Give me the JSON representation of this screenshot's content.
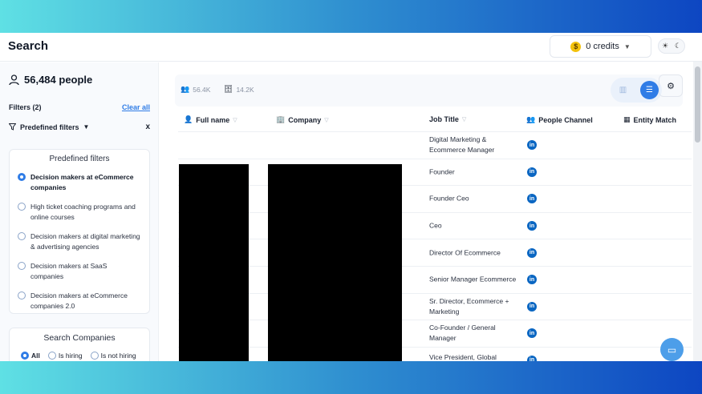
{
  "header": {
    "title": "Search",
    "credits": "0 credits",
    "coin_symbol": "$",
    "theme_icons": [
      "sun-icon",
      "moon-icon"
    ]
  },
  "sidebar": {
    "people_count": "56,484 people",
    "filters_label": "Filters (2)",
    "clear_all": "Clear all",
    "predefined_toggle": "Predefined filters",
    "close_symbol": "x",
    "predefined_panel": {
      "title": "Predefined filters",
      "options": [
        {
          "label": "Decision makers at eCommerce companies",
          "selected": true
        },
        {
          "label": "High ticket coaching programs and online courses",
          "selected": false
        },
        {
          "label": "Decision makers at digital marketing & advertising agencies",
          "selected": false
        },
        {
          "label": "Decision makers at SaaS companies",
          "selected": false
        },
        {
          "label": "Decision makers at eCommerce companies 2.0",
          "selected": false
        }
      ]
    },
    "search_companies": {
      "title": "Search Companies",
      "options": [
        {
          "label": "All",
          "selected": true
        },
        {
          "label": "Is hiring",
          "selected": false
        },
        {
          "label": "Is not hiring",
          "selected": false
        }
      ]
    }
  },
  "main": {
    "stats": {
      "people": "56.4K",
      "companies": "14.2K"
    },
    "columns": {
      "full_name": "Full name",
      "company": "Company",
      "job_title": "Job Title",
      "people_channel": "People Channel",
      "entity_match": "Entity Match"
    },
    "rows": [
      {
        "job_title": "Digital Marketing & Ecommerce Manager",
        "channel": "in"
      },
      {
        "job_title": "Founder",
        "channel": "in"
      },
      {
        "job_title": "Founder Ceo",
        "channel": "in"
      },
      {
        "job_title": "Ceo",
        "channel": "in"
      },
      {
        "job_title": "Director Of Ecommerce",
        "channel": "in"
      },
      {
        "job_title": "Senior Manager Ecommerce",
        "channel": "in"
      },
      {
        "job_title": "Sr. Director, Ecommerce + Marketing",
        "channel": "in"
      },
      {
        "job_title": "Co-Founder / General Manager",
        "channel": "in"
      },
      {
        "job_title": "Vice President, Global",
        "channel": "in"
      }
    ]
  },
  "colors": {
    "accent": "#2f7ce6",
    "linkedin": "#0a66c2",
    "coin": "#f3c20c",
    "redaction": "#000000"
  }
}
